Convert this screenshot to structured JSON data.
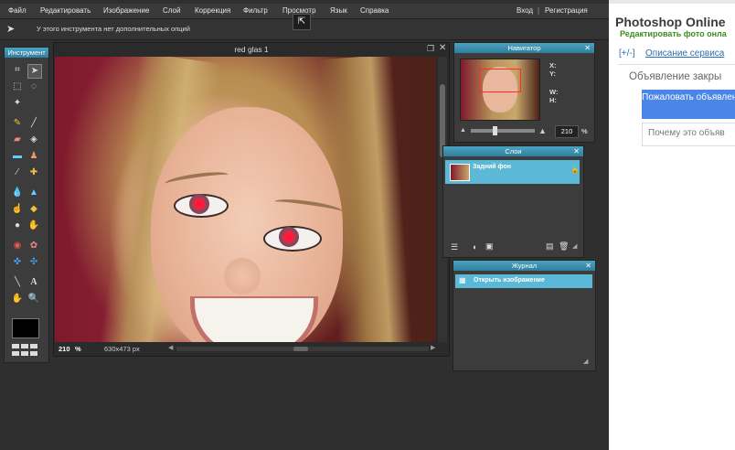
{
  "menu": {
    "items": [
      "Файл",
      "Редактировать",
      "Изображение",
      "Слой",
      "Коррекция",
      "Фильтр",
      "Просмотр",
      "Язык",
      "Справка"
    ],
    "login": "Вход",
    "separator": "|",
    "register": "Регистрация"
  },
  "options_bar": {
    "message": "У этого инструмента нет дополнительных опций"
  },
  "tools_panel": {
    "title": "Инструмент"
  },
  "document": {
    "title": "red glas 1",
    "zoom": "210",
    "zoom_unit": "%",
    "dimensions": "630x473 px"
  },
  "navigator": {
    "title": "Навигатор",
    "x_label": "X:",
    "y_label": "Y:",
    "w_label": "W:",
    "h_label": "H:",
    "zoom": "210",
    "zoom_unit": "%"
  },
  "layers": {
    "title": "Слои",
    "items": [
      {
        "name": "Задний фон"
      }
    ]
  },
  "history": {
    "title": "Журнал",
    "items": [
      {
        "label": "Открыть изображение"
      }
    ]
  },
  "sidebar": {
    "title": "Photoshop Online",
    "subtitle": "Редактировать фото онла",
    "toggle": "[+/-]",
    "link": "Описание сервиса",
    "ad_closed": "Объявление закры",
    "report_button": "Пожаловать объявлени",
    "why_button": "Почему это объяв"
  },
  "colors": {
    "accent": "#4aa3c2",
    "selection": "#5bb8d6",
    "sidebar_title": "#3a3a3a",
    "sidebar_subtitle": "#3c8d1e",
    "report_button": "#4a86e8"
  }
}
